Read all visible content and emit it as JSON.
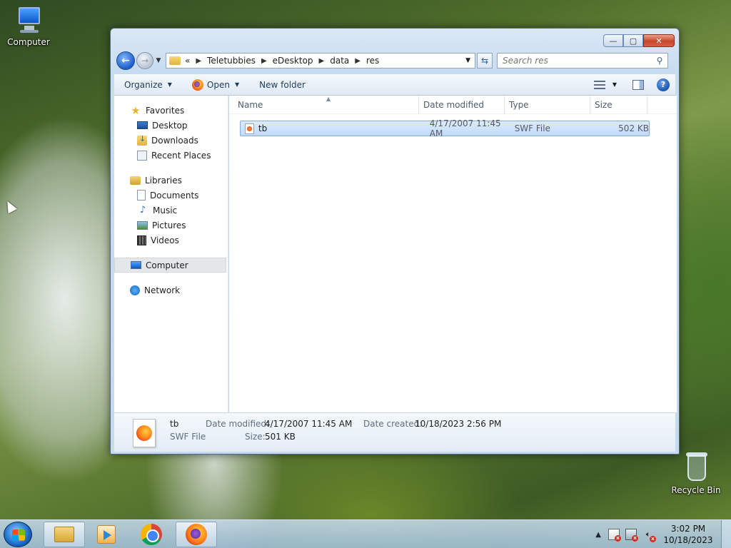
{
  "desktop": {
    "icons": [
      {
        "label": "Computer",
        "icon": "computer-icon"
      },
      {
        "label": "Recycle Bin",
        "icon": "recycle-bin-icon"
      }
    ]
  },
  "window": {
    "controls": {
      "minimize": "—",
      "maximize": "▢",
      "close": "✕"
    },
    "address": {
      "overflow": "«",
      "crumbs": [
        "Teletubbies",
        "eDesktop",
        "data",
        "res"
      ]
    },
    "search": {
      "placeholder": "Search res"
    },
    "commands": {
      "organize": "Organize",
      "open": "Open",
      "new_folder": "New folder"
    },
    "nav_pane": {
      "favorites": {
        "label": "Favorites",
        "items": [
          "Desktop",
          "Downloads",
          "Recent Places"
        ]
      },
      "libraries": {
        "label": "Libraries",
        "items": [
          "Documents",
          "Music",
          "Pictures",
          "Videos"
        ]
      },
      "computer": "Computer",
      "network": "Network"
    },
    "columns": [
      "Name",
      "Date modified",
      "Type",
      "Size"
    ],
    "files": [
      {
        "name": "tb",
        "date_modified": "4/17/2007 11:45 AM",
        "type": "SWF File",
        "size": "502 KB"
      }
    ],
    "details": {
      "name": "tb",
      "type": "SWF File",
      "date_modified_label": "Date modified:",
      "date_modified": "4/17/2007 11:45 AM",
      "size_label": "Size:",
      "size": "501 KB",
      "date_created_label": "Date created:",
      "date_created": "10/18/2023 2:56 PM"
    }
  },
  "taskbar": {
    "clock": {
      "time": "3:02 PM",
      "date": "10/18/2023"
    },
    "tray_overflow": "▲"
  }
}
